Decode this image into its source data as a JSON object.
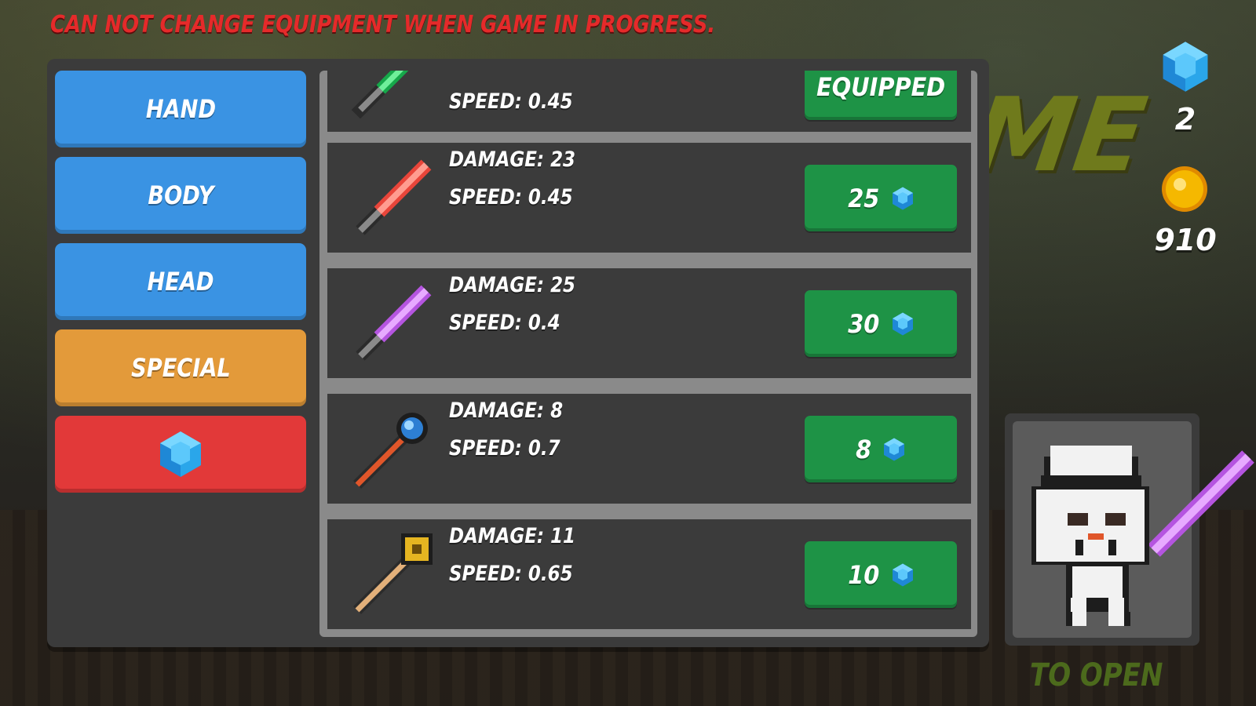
{
  "warning": "CAN NOT CHANGE EQUIPMENT WHEN GAME IN PROGRESS.",
  "background_title": "ME",
  "footer_hint": "TO OPEN",
  "tabs": [
    {
      "label": "HAND",
      "color": "#3a93e3"
    },
    {
      "label": "BODY",
      "color": "#3a93e3"
    },
    {
      "label": "HEAD",
      "color": "#3a93e3"
    },
    {
      "label": "SPECIAL",
      "color": "#e39a3a"
    },
    {
      "label": "",
      "icon": "gem-icon",
      "color": "#e23939"
    }
  ],
  "items": [
    {
      "weapon": "green-lightsaber",
      "damage": "",
      "speed": "SPEED: 0.45",
      "button": "EQUIPPED",
      "price": "",
      "equipped": true
    },
    {
      "weapon": "red-lightsaber",
      "damage": "DAMAGE: 23",
      "speed": "SPEED: 0.45",
      "button": "",
      "price": "25",
      "equipped": false
    },
    {
      "weapon": "purple-lightsaber",
      "damage": "DAMAGE: 25",
      "speed": "SPEED: 0.4",
      "button": "",
      "price": "30",
      "equipped": false
    },
    {
      "weapon": "blue-orb-staff",
      "damage": "DAMAGE: 8",
      "speed": "SPEED: 0.7",
      "button": "",
      "price": "8",
      "equipped": false
    },
    {
      "weapon": "gold-hammer-staff",
      "damage": "DAMAGE: 11",
      "speed": "SPEED: 0.65",
      "button": "",
      "price": "10",
      "equipped": false
    }
  ],
  "currency": {
    "gems": "2",
    "coins": "910"
  },
  "colors": {
    "warning": "#e52a2a",
    "button_green": "#1e9346",
    "gem": "#3ab6ef",
    "coin": "#f5b800"
  }
}
